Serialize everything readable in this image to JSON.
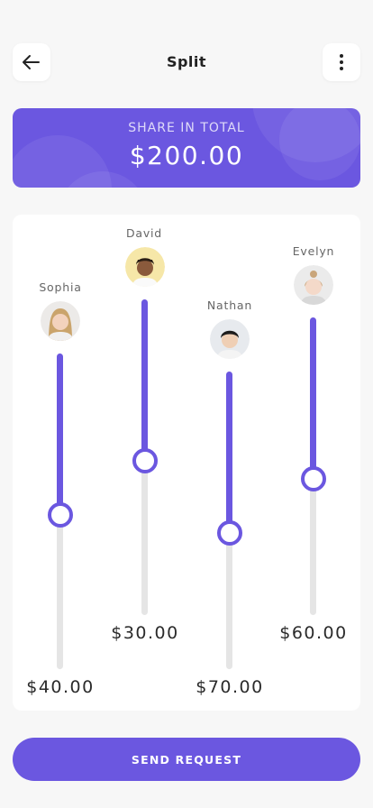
{
  "header": {
    "title": "Split",
    "back_icon": "arrow-left-icon",
    "menu_icon": "more-vertical-icon"
  },
  "summary": {
    "label": "SHARE IN TOTAL",
    "amount": "$200.00"
  },
  "people": [
    {
      "name": "Sophia",
      "amount": "$40.00",
      "share_fraction": 0.5,
      "avatar": "avatar-sophia"
    },
    {
      "name": "David",
      "amount": "$30.00",
      "share_fraction": 0.5,
      "avatar": "avatar-david"
    },
    {
      "name": "Nathan",
      "amount": "$70.00",
      "share_fraction": 0.54,
      "avatar": "avatar-nathan"
    },
    {
      "name": "Evelyn",
      "amount": "$60.00",
      "share_fraction": 0.54,
      "avatar": "avatar-evelyn"
    }
  ],
  "action": {
    "send_label": "SEND REQUEST"
  },
  "colors": {
    "accent": "#6b57e0",
    "track": "#e5e5e5",
    "background": "#f7f7f7"
  }
}
